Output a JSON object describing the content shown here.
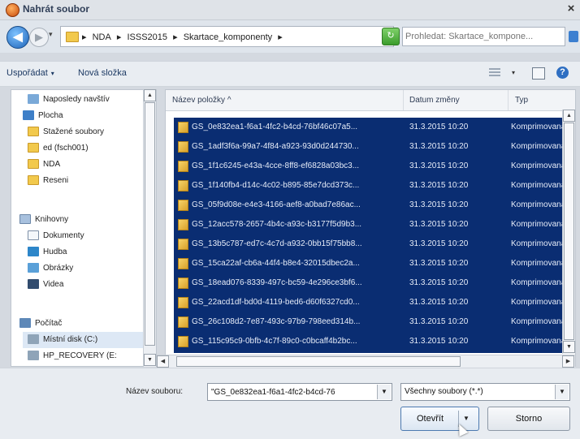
{
  "window": {
    "title": "Nahrát soubor",
    "close_glyph": "×",
    "icon": "upload-dialog-icon"
  },
  "navigation": {
    "back_glyph": "◀",
    "forward_glyph": "▶",
    "history_glyph": "▾",
    "breadcrumb": [
      "NDA",
      "ISSS2015",
      "Skartace_komponenty"
    ],
    "crumb_separator": "▸",
    "refresh_glyph": "↻",
    "search_placeholder": "Prohledat: Skartace_kompone..."
  },
  "toolbar": {
    "organize_label": "Uspořádat",
    "new_folder_label": "Nová složka",
    "caret_glyph": "▾",
    "help_glyph": "?"
  },
  "nav_pane": {
    "items": [
      {
        "label": "Naposledy navštív",
        "icon": "recent-places-icon"
      },
      {
        "label": "Plocha",
        "icon": "desktop-icon"
      },
      {
        "label": "Stažené soubory",
        "icon": "downloads-icon"
      },
      {
        "label": "ed (fsch001)",
        "icon": "folder-icon"
      },
      {
        "label": "NDA",
        "icon": "folder-icon"
      },
      {
        "label": "Reseni",
        "icon": "folder-icon"
      },
      {
        "label": "Knihovny",
        "icon": "libraries-icon"
      },
      {
        "label": "Dokumenty",
        "icon": "documents-icon"
      },
      {
        "label": "Hudba",
        "icon": "music-icon"
      },
      {
        "label": "Obrázky",
        "icon": "pictures-icon"
      },
      {
        "label": "Videa",
        "icon": "videos-icon"
      },
      {
        "label": "Počítač",
        "icon": "computer-icon"
      },
      {
        "label": "Místní disk (C:)",
        "icon": "local-disk-icon"
      },
      {
        "label": "HP_RECOVERY (E:",
        "icon": "recovery-disk-icon"
      }
    ]
  },
  "file_list": {
    "columns": {
      "name": "Název položky",
      "date": "Datum změny",
      "type": "Typ"
    },
    "sort_glyph": "^",
    "rows": [
      {
        "name": "GS_0e832ea1-f6a1-4fc2-b4cd-76bf46c07a5...",
        "date": "31.3.2015 10:20",
        "type": "Komprimovaná"
      },
      {
        "name": "GS_1adf3f6a-99a7-4f84-a923-93d0d244730...",
        "date": "31.3.2015 10:20",
        "type": "Komprimovaná"
      },
      {
        "name": "GS_1f1c6245-e43a-4cce-8ff8-ef6828a03bc3...",
        "date": "31.3.2015 10:20",
        "type": "Komprimovaná"
      },
      {
        "name": "GS_1f140fb4-d14c-4c02-b895-85e7dcd373c...",
        "date": "31.3.2015 10:20",
        "type": "Komprimovaná"
      },
      {
        "name": "GS_05f9d08e-e4e3-4166-aef8-a0bad7e86ac...",
        "date": "31.3.2015 10:20",
        "type": "Komprimovaná"
      },
      {
        "name": "GS_12acc578-2657-4b4c-a93c-b3177f5d9b3...",
        "date": "31.3.2015 10:20",
        "type": "Komprimovaná"
      },
      {
        "name": "GS_13b5c787-ed7c-4c7d-a932-0bb15f75bb8...",
        "date": "31.3.2015 10:20",
        "type": "Komprimovaná"
      },
      {
        "name": "GS_15ca22af-cb6a-44f4-b8e4-32015dbec2a...",
        "date": "31.3.2015 10:20",
        "type": "Komprimovaná"
      },
      {
        "name": "GS_18ead076-8339-497c-bc59-4e296ce3bf6...",
        "date": "31.3.2015 10:20",
        "type": "Komprimovaná"
      },
      {
        "name": "GS_22acd1df-bd0d-4119-bed6-d60f6327cd0...",
        "date": "31.3.2015 10:20",
        "type": "Komprimovaná"
      },
      {
        "name": "GS_26c108d2-7e87-493c-97b9-798eed314b...",
        "date": "31.3.2015 10:20",
        "type": "Komprimovaná"
      },
      {
        "name": "GS_115c95c9-0bfb-4c7f-89c0-c0bcaff4b2bc...",
        "date": "31.3.2015 10:20",
        "type": "Komprimovaná"
      }
    ]
  },
  "bottom": {
    "filename_label": "Název souboru:",
    "filename_value": "\"GS_0e832ea1-f6a1-4fc2-b4cd-76",
    "filetype_value": "Všechny soubory (*.*)",
    "open_label": "Otevřít",
    "cancel_label": "Storno",
    "dropdown_glyph": "▼"
  },
  "scroll": {
    "up": "▲",
    "down": "▼",
    "left": "◀",
    "right": "▶"
  },
  "colors": {
    "selection": "#0a2d72",
    "accent": "#1d63b8",
    "folder": "#f2c94c"
  }
}
